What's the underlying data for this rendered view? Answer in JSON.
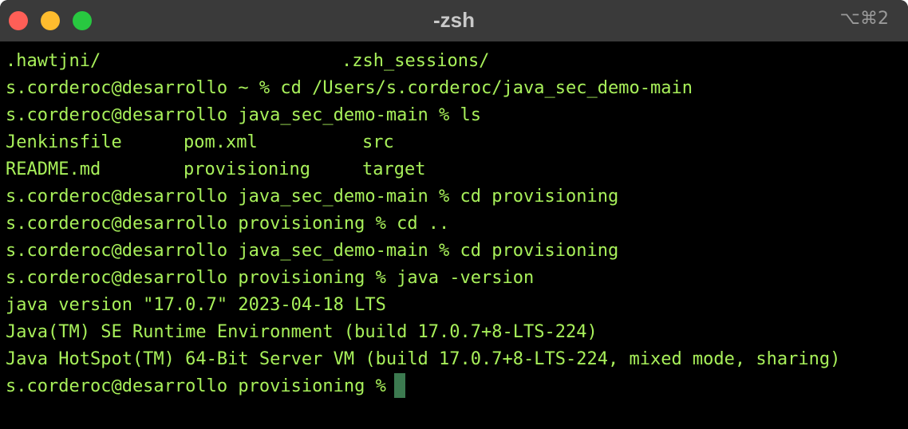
{
  "window": {
    "title": "-zsh",
    "shortcut": "⌥⌘2"
  },
  "colors": {
    "terminal_bg": "#000000",
    "terminal_text": "#a8f05a",
    "titlebar_bg": "#3a3a3a",
    "close": "#ff5f57",
    "minimize": "#febc2e",
    "maximize": "#28c840",
    "cursor": "#3c7a50"
  },
  "terminal": {
    "line1": [
      ".hawtjni/",
      ".zsh_sessions/"
    ],
    "line2": "s.corderoc@desarrollo ~ % cd /Users/s.corderoc/java_sec_demo-main",
    "line3": "s.corderoc@desarrollo java_sec_demo-main % ls",
    "ls_row1": [
      "Jenkinsfile",
      "pom.xml",
      "src"
    ],
    "ls_row2": [
      "README.md",
      "provisioning",
      "target"
    ],
    "line6": "s.corderoc@desarrollo java_sec_demo-main % cd provisioning",
    "line7": "s.corderoc@desarrollo provisioning % cd ..",
    "line8": "s.corderoc@desarrollo java_sec_demo-main % cd provisioning",
    "line9": "s.corderoc@desarrollo provisioning % java -version",
    "line10": "java version \"17.0.7\" 2023-04-18 LTS",
    "line11": "Java(TM) SE Runtime Environment (build 17.0.7+8-LTS-224)",
    "line12": "Java HotSpot(TM) 64-Bit Server VM (build 17.0.7+8-LTS-224, mixed mode, sharing)",
    "prompt": "s.corderoc@desarrollo provisioning %"
  }
}
